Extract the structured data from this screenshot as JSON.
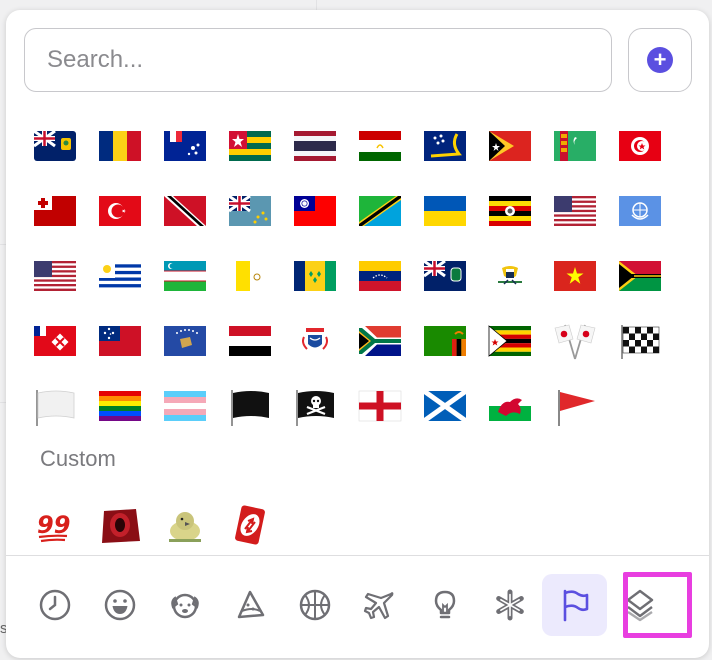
{
  "search": {
    "placeholder": "Search..."
  },
  "add_button": {
    "icon": "plus-circle-icon"
  },
  "flags": [
    "turks-caicos-flag",
    "romania-flag",
    "french-southern-flag",
    "togo-flag",
    "thailand-flag",
    "tajikistan-flag",
    "tokelau-flag",
    "timor-leste-flag",
    "turkmenistan-flag",
    "tunisia-flag",
    "tonga-flag",
    "turkey-flag",
    "trinidad-tobago-flag",
    "tuvalu-flag",
    "taiwan-flag",
    "tanzania-flag",
    "ukraine-flag",
    "uganda-flag",
    "us-outlying-islands-flag",
    "united-nations-flag",
    "united-states-flag",
    "uruguay-flag",
    "uzbekistan-flag",
    "vatican-city-flag",
    "st-vincent-flag",
    "venezuela-flag",
    "british-virgin-islands-flag",
    "us-virgin-islands-flag",
    "vietnam-flag",
    "vanuatu-flag",
    "wallis-futuna-flag",
    "samoa-flag",
    "kosovo-flag",
    "yemen-flag",
    "mayotte-flag",
    "south-africa-flag",
    "zambia-flag",
    "zimbabwe-flag",
    "crossed-flags",
    "chequered-flag",
    "white-flag",
    "rainbow-flag",
    "transgender-flag",
    "black-flag",
    "pirate-flag",
    "england-flag",
    "scotland-flag",
    "wales-flag",
    "triangular-flag"
  ],
  "custom": {
    "label": "Custom",
    "items": [
      "hundred-points-emoji",
      "red-gem-emoji",
      "parrot-emoji",
      "uno-reverse-card-emoji"
    ]
  },
  "tabs": [
    {
      "icon": "clock-icon",
      "active": false
    },
    {
      "icon": "smiley-icon",
      "active": false
    },
    {
      "icon": "dog-icon",
      "active": false
    },
    {
      "icon": "pizza-icon",
      "active": false
    },
    {
      "icon": "basketball-icon",
      "active": false
    },
    {
      "icon": "airplane-icon",
      "active": false
    },
    {
      "icon": "lightbulb-icon",
      "active": false
    },
    {
      "icon": "asterisk-icon",
      "active": false
    },
    {
      "icon": "flag-icon",
      "active": true
    },
    {
      "icon": "layers-icon",
      "active": false
    }
  ],
  "colors": {
    "accent": "#5b4fe0",
    "active_tab_bg": "#eceafd",
    "highlight": "#e83ee0"
  }
}
